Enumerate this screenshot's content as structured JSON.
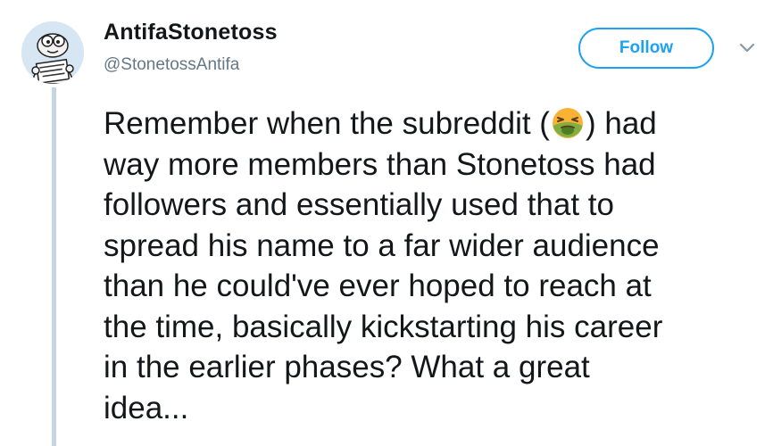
{
  "user": {
    "display_name": "AntifaStonetoss",
    "handle": "@StonetossAntifa",
    "avatar_sign_text": "TRANS RIGHTS ARE HUMAN RIGHTS"
  },
  "actions": {
    "follow_label": "Follow",
    "menu_icon": "chevron-down-icon"
  },
  "tweet": {
    "emoji_icon": "nauseated-face-emoji",
    "line1_before_emoji": "Remember when the subreddit (",
    "line1_after_emoji": ") had",
    "lines": [
      "way more members than Stonetoss had",
      "followers and essentially used that to",
      "spread his name to a far wider audience",
      "than he could've ever hoped to reach at",
      "the time, basically kickstarting his career",
      "in the earlier phases? What a great",
      "idea..."
    ]
  },
  "colors": {
    "accent": "#1da1f2",
    "secondary_text": "#657786",
    "primary_text": "#14171a",
    "thread_line": "#c4d6e4"
  }
}
